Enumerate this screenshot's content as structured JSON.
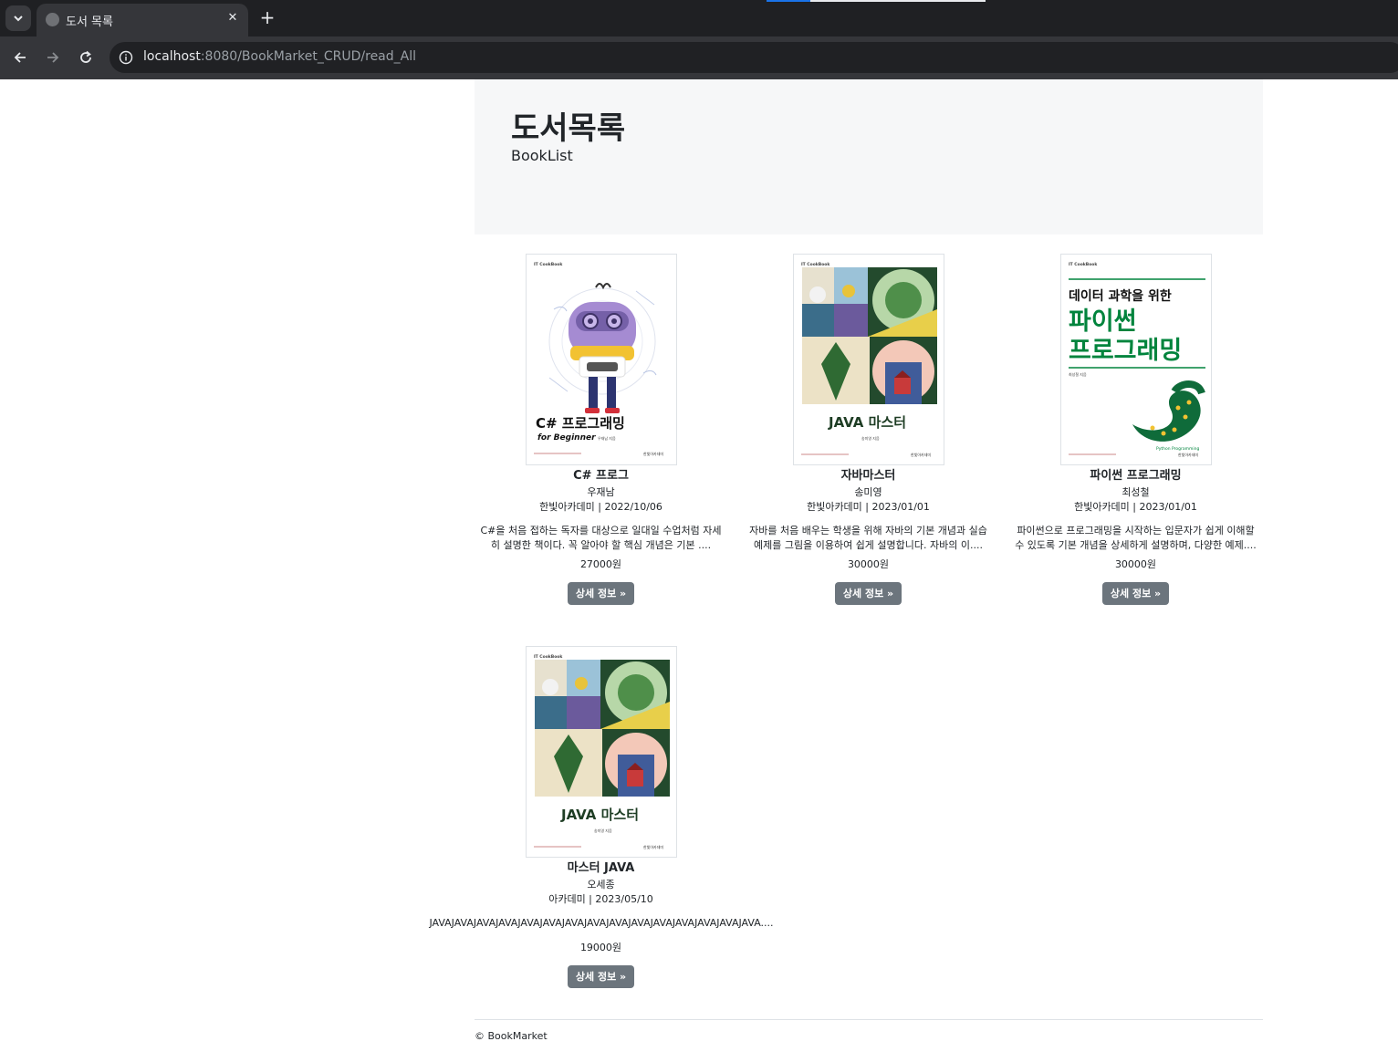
{
  "browser": {
    "tab_title": "도서 목록",
    "url_host": "localhost",
    "url_rest": ":8080/BookMarket_CRUD/read_All"
  },
  "header": {
    "title": "도서목록",
    "subtitle": "BookList"
  },
  "books": [
    {
      "title": "C# 프로그",
      "author": "우재남",
      "publisher_date": "한빛아카데미 | 2022/10/06",
      "description": "C#을 처음 접하는 독자를 대상으로 일대일 수업처럼 자세히 설명한 책이다. 꼭 알아야 할 핵심 개념은 기본 ....",
      "price": "27000원",
      "button": "상세 정보 »",
      "cover": {
        "brand": "IT CookBook",
        "title": "C# 프로그래밍",
        "subtitle": "for Beginner",
        "author": "우재남 지음",
        "publisher": "한빛아카데미"
      }
    },
    {
      "title": "자바마스터",
      "author": "송미영",
      "publisher_date": "한빛아카데미 | 2023/01/01",
      "description": "자바를 처음 배우는 학생을 위해 자바의 기본 개념과 실습 예제를 그림을 이용하여 쉽게 설명합니다. 자바의 이....",
      "price": "30000원",
      "button": "상세 정보 »",
      "cover": {
        "brand": "IT CookBook",
        "title": "JAVA 마스터",
        "author": "송미영 지음",
        "publisher": "한빛아카데미"
      }
    },
    {
      "title": "파이썬 프로그래밍",
      "author": "최성철",
      "publisher_date": "한빛아카데미 | 2023/01/01",
      "description": "파이썬으로 프로그래밍을 시작하는 입문자가 쉽게 이해할 수 있도록 기본 개념을 상세하게 설명하며, 다양한 예제....",
      "price": "30000원",
      "button": "상세 정보 »",
      "cover": {
        "brand": "IT CookBook",
        "line1": "데이터 과학을 위한",
        "line2": "파이썬",
        "line3": "프로그래밍",
        "tag": "Python Programming",
        "author": "최성철 지음",
        "publisher": "한빛아카데미"
      }
    },
    {
      "title": "마스터 JAVA",
      "author": "오세종",
      "publisher_date": "아카데미 | 2023/05/10",
      "description": "JAVAJAVAJAVAJAVAJAVAJAVAJAVAJAVAJAVAJAVAJAVAJAVAJAVAJAVAJAVA....",
      "price": "19000원",
      "button": "상세 정보 »",
      "cover": {
        "brand": "IT CookBook",
        "title": "JAVA 마스터",
        "author": "송미영 지음",
        "publisher": "한빛아카데미"
      }
    }
  ],
  "footer": {
    "text": "© BookMarket"
  },
  "colors": {
    "button": "#6c757d",
    "jumbotron": "#f6f7f8",
    "python_green": "#00843d"
  }
}
